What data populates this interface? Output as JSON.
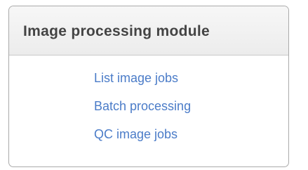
{
  "panel": {
    "title": "Image processing module",
    "links": [
      {
        "label": "List image jobs"
      },
      {
        "label": "Batch processing"
      },
      {
        "label": "QC image jobs"
      }
    ]
  },
  "colors": {
    "link": "#4b7cc8",
    "title": "#444444",
    "header_bg": "#efefef",
    "border": "#aaaaaa"
  }
}
